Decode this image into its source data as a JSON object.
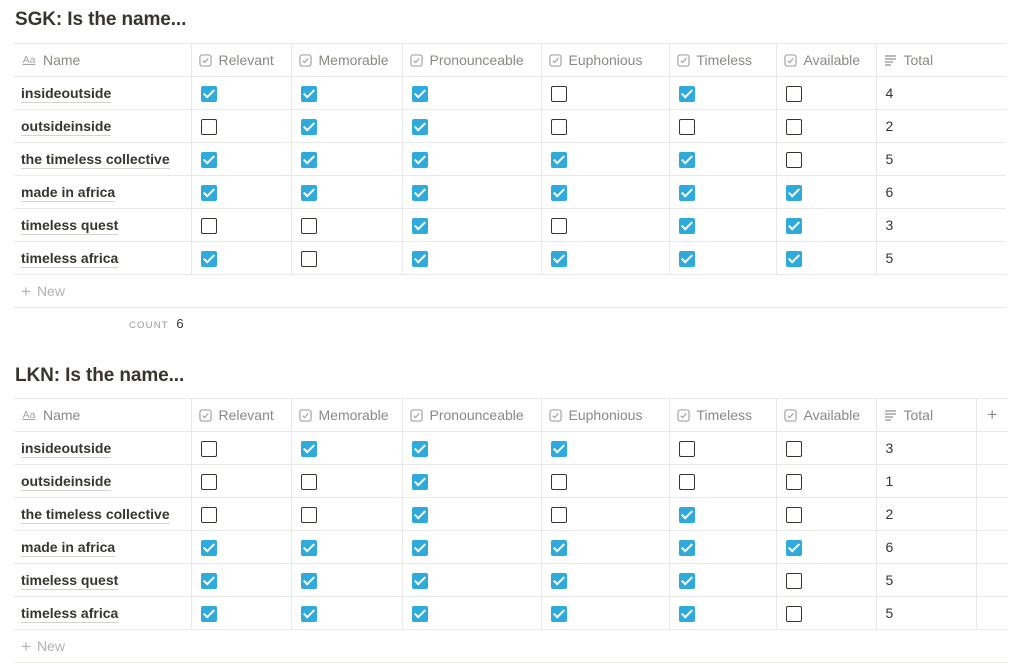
{
  "headers": {
    "name": "Name",
    "relevant": "Relevant",
    "memorable": "Memorable",
    "pronounceable": "Pronounceable",
    "euphonious": "Euphonious",
    "timeless": "Timeless",
    "available": "Available",
    "total": "Total"
  },
  "name_icon": "Aa",
  "new_label": "New",
  "add_column_glyph": "+",
  "colors": {
    "checked": "#2eaadc",
    "border": "#e9e9e7",
    "text": "#37352f",
    "muted": "#8a8984"
  },
  "sgk": {
    "title": "SGK: Is the name...",
    "count_label": "COUNT",
    "count_value": "6",
    "rows": [
      {
        "name": "insideoutside",
        "checks": [
          true,
          true,
          true,
          false,
          true,
          false
        ],
        "total": "4"
      },
      {
        "name": "outsideinside",
        "checks": [
          false,
          true,
          true,
          false,
          false,
          false
        ],
        "total": "2"
      },
      {
        "name": "the timeless collective",
        "checks": [
          true,
          true,
          true,
          true,
          true,
          false
        ],
        "total": "5"
      },
      {
        "name": "made in africa",
        "checks": [
          true,
          true,
          true,
          true,
          true,
          true
        ],
        "total": "6"
      },
      {
        "name": "timeless quest",
        "checks": [
          false,
          false,
          true,
          false,
          true,
          true
        ],
        "total": "3"
      },
      {
        "name": "timeless africa",
        "checks": [
          true,
          false,
          true,
          true,
          true,
          true
        ],
        "total": "5"
      }
    ]
  },
  "lkn": {
    "title": "LKN: Is the name...",
    "rows": [
      {
        "name": "insideoutside",
        "checks": [
          false,
          true,
          true,
          true,
          false,
          false
        ],
        "total": "3"
      },
      {
        "name": "outsideinside",
        "checks": [
          false,
          false,
          true,
          false,
          false,
          false
        ],
        "total": "1"
      },
      {
        "name": "the timeless collective",
        "checks": [
          false,
          false,
          true,
          false,
          true,
          false
        ],
        "total": "2"
      },
      {
        "name": "made in africa",
        "checks": [
          true,
          true,
          true,
          true,
          true,
          true
        ],
        "total": "6"
      },
      {
        "name": "timeless quest",
        "checks": [
          true,
          true,
          true,
          true,
          true,
          false
        ],
        "total": "5"
      },
      {
        "name": "timeless africa",
        "checks": [
          true,
          true,
          true,
          true,
          true,
          false
        ],
        "total": "5"
      }
    ]
  }
}
